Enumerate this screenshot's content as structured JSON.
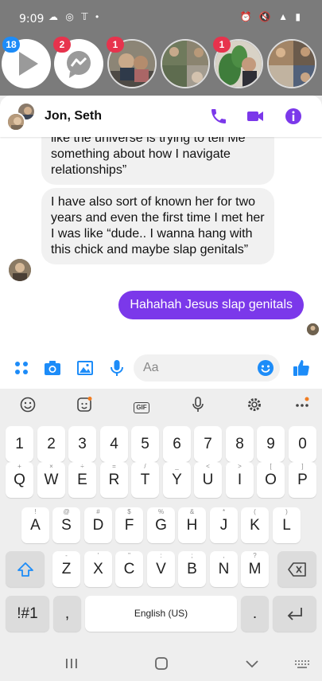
{
  "status_bar": {
    "time": "9:09"
  },
  "chat_heads": {
    "badges": [
      "18",
      "2",
      "1",
      "1"
    ]
  },
  "chat": {
    "title": "Jon, Seth",
    "messages": [
      {
        "direction": "incoming",
        "text": "like the universe is trying to tell Me something about how I navigate relationships”"
      },
      {
        "direction": "incoming",
        "text": "I have also sort of known her for two years and even the first time I met her I was like “dude.. I wanna hang with this chick and maybe slap genitals”"
      },
      {
        "direction": "outgoing",
        "text": "Hahahah Jesus slap genitals"
      }
    ],
    "composer": {
      "placeholder": "Aa"
    }
  },
  "keyboard": {
    "number_row": [
      "1",
      "2",
      "3",
      "4",
      "5",
      "6",
      "7",
      "8",
      "9",
      "0"
    ],
    "row1": [
      "Q",
      "W",
      "E",
      "R",
      "T",
      "Y",
      "U",
      "I",
      "O",
      "P"
    ],
    "row1_hints": [
      "+",
      "×",
      "÷",
      "=",
      "/",
      "_",
      "<",
      ">",
      "[",
      "]"
    ],
    "row2": [
      "A",
      "S",
      "D",
      "F",
      "G",
      "H",
      "J",
      "K",
      "L"
    ],
    "row2_hints": [
      "!",
      "@",
      "#",
      "$",
      "%",
      "&",
      "*",
      "(",
      ")"
    ],
    "row3": [
      "Z",
      "X",
      "C",
      "V",
      "B",
      "N",
      "M"
    ],
    "row3_hints": [
      "-",
      "'",
      "\"",
      ":",
      ";",
      ",",
      "?"
    ],
    "symbols_key": "!#1",
    "comma_key": ",",
    "space_label": "English (US)",
    "period_key": ".",
    "gif_label": "GIF"
  },
  "colors": {
    "accent_purple": "#7b38ea",
    "icon_blue": "#1d8cf8",
    "badge_red": "#e7334d"
  }
}
